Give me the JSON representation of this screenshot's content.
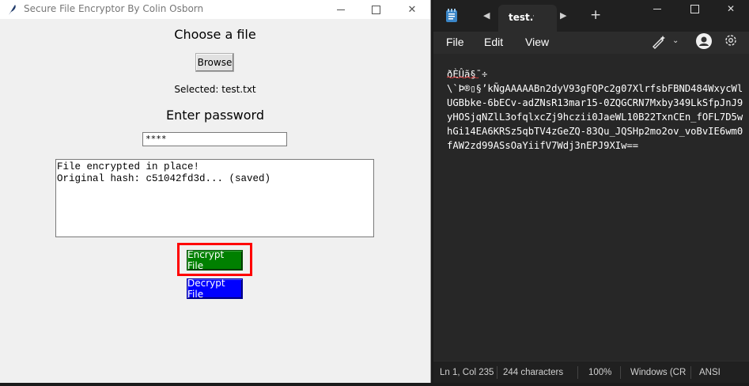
{
  "tk_window": {
    "title": "Secure File Encryptor By Colin Osborn",
    "choose_label": "Choose a file",
    "browse_label": "Browse",
    "selected_label": "Selected: test.txt",
    "password_label": "Enter password",
    "password_value": "****",
    "output_text": "File encrypted in place!\nOriginal hash: c51042fd3d... (saved)",
    "encrypt_label": "Encrypt File",
    "decrypt_label": "Decrypt File",
    "colors": {
      "encrypt_bg": "#008000",
      "decrypt_bg": "#0000ff",
      "highlight": "#ff0000"
    }
  },
  "notepad": {
    "tab_label": "test.txt",
    "menus": [
      "File",
      "Edit",
      "View"
    ],
    "content": "ðÈÛã§¯÷\n\\`Þ®▯§’kÑgAAAAABn2dyV93gFQPc2g07XlrfsbFBND484WxycWlUGBbke-6bECv-adZNsR13mar15-0ZQGCRN7Mxby349LkSfpJnJ9yHOSjqNZlL3ofqlxcZj9hczii0JaeWL10B22TxnCEn_fOFL7D5whGi14EA6KRSz5qbTV4zGeZQ-83Qu_JQSHp2mo2ov_voBvIE6wm0fAW2zd99ASsOaYiifV7Wdj3nEPJ9XIw==",
    "status": {
      "position": "Ln 1, Col 235",
      "chars": "244 characters",
      "zoom": "100%",
      "line_ending": "Windows (CRLF)",
      "encoding": "ANSI"
    },
    "icons": [
      "notepad-app-icon",
      "copilot-icon",
      "account-icon",
      "settings-gear-icon"
    ]
  }
}
